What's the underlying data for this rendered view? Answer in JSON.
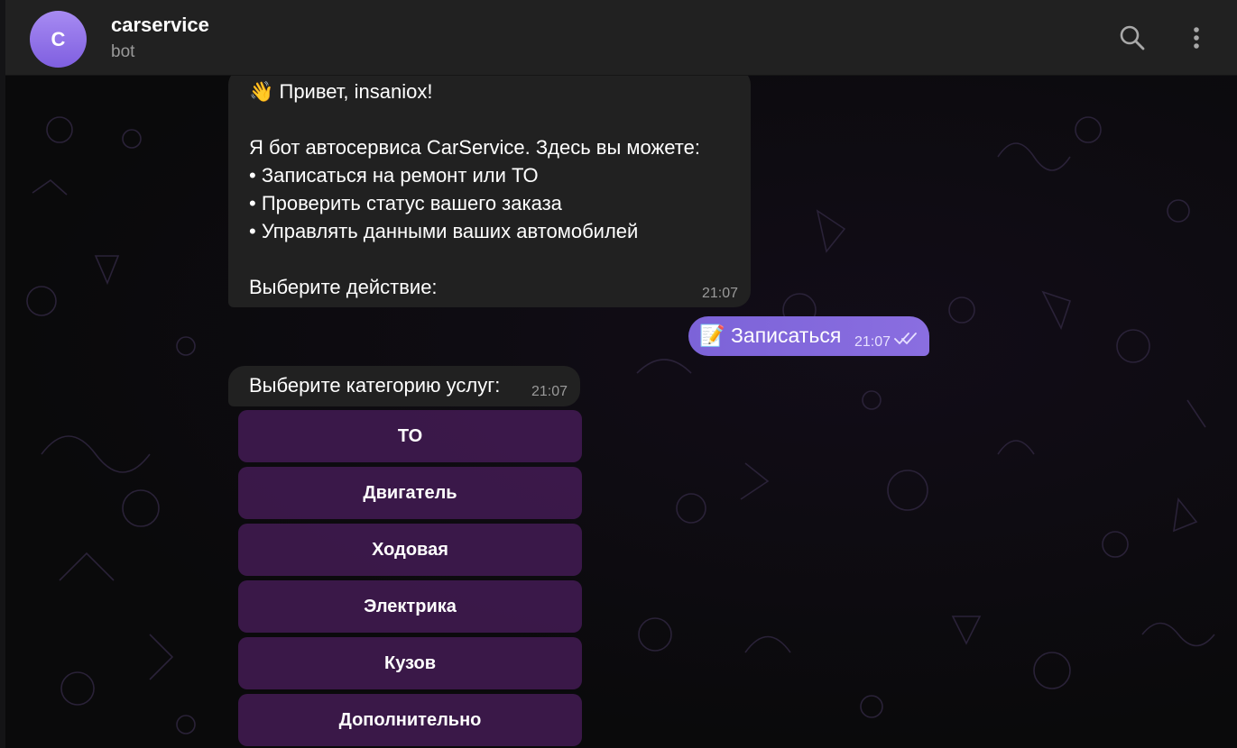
{
  "header": {
    "avatar_letter": "C",
    "title": "carservice",
    "subtitle": "bot",
    "search_icon": "search-icon",
    "menu_icon": "more-vertical-icon"
  },
  "colors": {
    "avatar": "#8b6ae8",
    "outgoing_bubble": "#8266db",
    "incoming_bubble": "#212121",
    "keyboard_button": "#481c5a",
    "header_bg": "#212121"
  },
  "messages": {
    "welcome": {
      "lines": [
        "👋 Привет, insaniox!",
        "",
        "Я бот автосервиса CarService. Здесь вы можете:",
        "• Записаться на ремонт или ТО",
        "• Проверить статус вашего заказа",
        "• Управлять данными ваших автомобилей",
        "",
        "Выберите действие:"
      ],
      "time": "21:07"
    },
    "outgoing": {
      "text": "📝 Записаться",
      "time": "21:07",
      "status_icon": "double-check-icon"
    },
    "category": {
      "text": "Выберите категорию услуг:",
      "time": "21:07"
    }
  },
  "keyboard": {
    "buttons": [
      "ТО",
      "Двигатель",
      "Ходовая",
      "Электрика",
      "Кузов",
      "Дополнительно"
    ]
  }
}
